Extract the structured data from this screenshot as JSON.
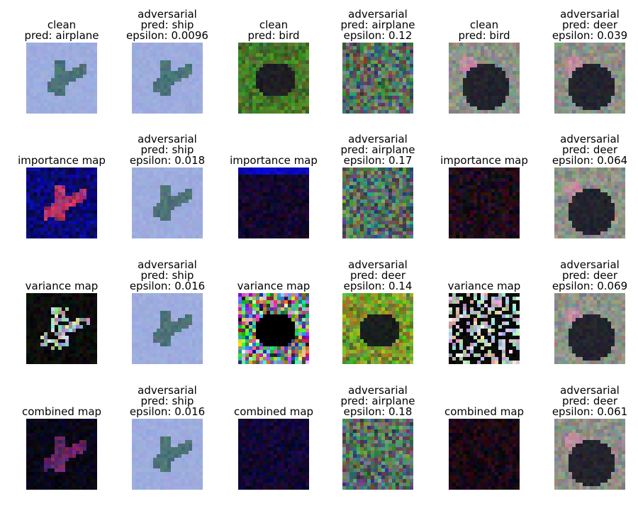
{
  "figure": {
    "rows": [
      [
        {
          "lines": [
            "clean",
            "pred: airplane"
          ],
          "icon": "airplane-image"
        },
        {
          "lines": [
            "adversarial",
            "pred: ship",
            "epsilon: 0.0096"
          ],
          "icon": "airplane-image"
        },
        {
          "lines": [
            "clean",
            "pred: bird"
          ],
          "icon": "bird-dark-image"
        },
        {
          "lines": [
            "adversarial",
            "pred: airplane",
            "epsilon: 0.12"
          ],
          "icon": "bird-dark-noisy-image"
        },
        {
          "lines": [
            "clean",
            "pred: bird"
          ],
          "icon": "bird-ostrich-image"
        },
        {
          "lines": [
            "adversarial",
            "pred: deer",
            "epsilon: 0.039"
          ],
          "icon": "bird-ostrich-image"
        }
      ],
      [
        {
          "lines": [
            "importance map"
          ],
          "icon": "importance-map-airplane"
        },
        {
          "lines": [
            "adversarial",
            "pred: ship",
            "epsilon: 0.018"
          ],
          "icon": "airplane-image"
        },
        {
          "lines": [
            "importance map"
          ],
          "icon": "importance-map-dark"
        },
        {
          "lines": [
            "adversarial",
            "pred: airplane",
            "epsilon: 0.17"
          ],
          "icon": "bird-dark-noisy-image"
        },
        {
          "lines": [
            "importance map"
          ],
          "icon": "importance-map-ostrich"
        },
        {
          "lines": [
            "adversarial",
            "pred: deer",
            "epsilon: 0.064"
          ],
          "icon": "bird-ostrich-image"
        }
      ],
      [
        {
          "lines": [
            "variance map"
          ],
          "icon": "variance-map-airplane"
        },
        {
          "lines": [
            "adversarial",
            "pred: ship",
            "epsilon: 0.016"
          ],
          "icon": "airplane-image"
        },
        {
          "lines": [
            "variance map"
          ],
          "icon": "variance-map-bird"
        },
        {
          "lines": [
            "adversarial",
            "pred: deer",
            "epsilon: 0.14"
          ],
          "icon": "bird-dark-green-image"
        },
        {
          "lines": [
            "variance map"
          ],
          "icon": "variance-map-ostrich"
        },
        {
          "lines": [
            "adversarial",
            "pred: deer",
            "epsilon: 0.069"
          ],
          "icon": "bird-ostrich-image"
        }
      ],
      [
        {
          "lines": [
            "combined map"
          ],
          "icon": "combined-map-airplane"
        },
        {
          "lines": [
            "adversarial",
            "pred: ship",
            "epsilon: 0.016"
          ],
          "icon": "airplane-image"
        },
        {
          "lines": [
            "combined map"
          ],
          "icon": "combined-map-dark"
        },
        {
          "lines": [
            "adversarial",
            "pred: airplane",
            "epsilon: 0.18"
          ],
          "icon": "bird-dark-noisy-image"
        },
        {
          "lines": [
            "combined map"
          ],
          "icon": "combined-map-ostrich"
        },
        {
          "lines": [
            "adversarial",
            "pred: deer",
            "epsilon: 0.061"
          ],
          "icon": "bird-ostrich-image"
        }
      ]
    ]
  }
}
